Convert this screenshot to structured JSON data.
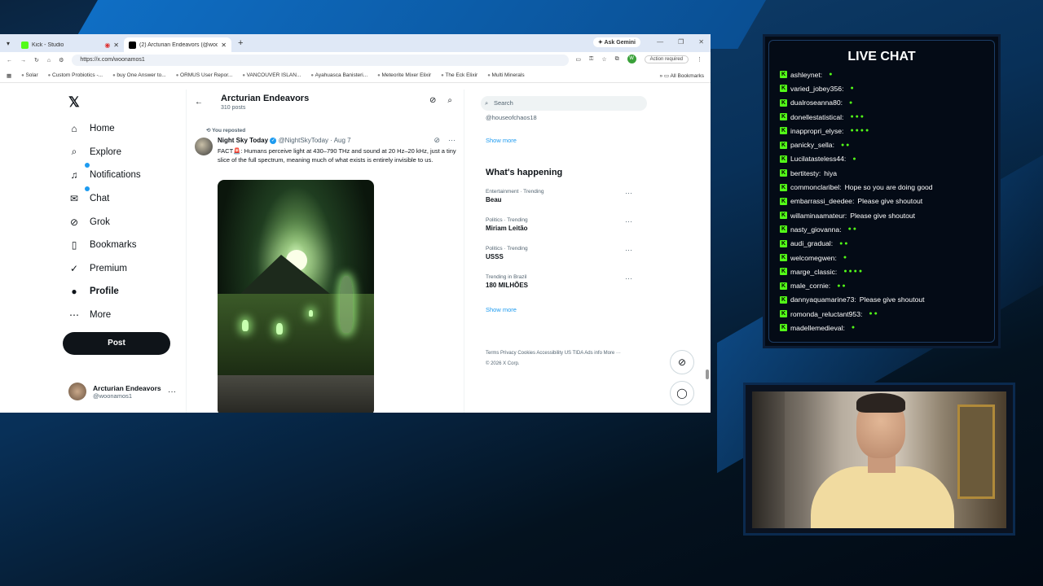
{
  "browser": {
    "tabs": [
      {
        "title": "Kick - Studio",
        "color": "#53fc18",
        "active": false
      },
      {
        "title": "(2) Arcturian Endeavors (@woo…",
        "color": "#000000",
        "active": true
      }
    ],
    "ask_gemini": "Ask Gemini",
    "url": "https://x.com/woonamos1",
    "profile_initial": "W",
    "action_required": "Action required",
    "bookmarks": [
      "Solar",
      "Custom Probiotics -...",
      "buy One Answer to...",
      "ORMUS User Repor...",
      "VANCOUVER ISLAN...",
      "Ayahuasca Banisteri...",
      "Meteorite Mixer Elixir",
      "The Eck Elixir",
      "Multi Minerals"
    ],
    "all_bookmarks": "All Bookmarks"
  },
  "nav": {
    "items": [
      {
        "label": "Home",
        "icon": "⌂"
      },
      {
        "label": "Explore",
        "icon": "⌕"
      },
      {
        "label": "Notifications",
        "icon": "🔔"
      },
      {
        "label": "Chat",
        "icon": "✉"
      },
      {
        "label": "Grok",
        "icon": "⊘"
      },
      {
        "label": "Bookmarks",
        "icon": "▯"
      },
      {
        "label": "Premium",
        "icon": "✓"
      },
      {
        "label": "Profile",
        "icon": "👤"
      },
      {
        "label": "More",
        "icon": "⋯"
      }
    ],
    "post_label": "Post",
    "account_name": "Arcturian Endeavors",
    "account_handle": "@woonamos1"
  },
  "profile_header": {
    "title": "Arcturian Endeavors",
    "subtitle": "310 posts"
  },
  "tweet": {
    "repost_label": "You reposted",
    "author": "Night Sky Today",
    "handle_date": "@NightSkyToday · Aug 7",
    "text": "FACT🚨: Humans perceive light at 430–790 THz and sound at 20 Hz–20 kHz, just a tiny slice of the full spectrum, meaning much of what exists is entirely invisible to us."
  },
  "sidebar": {
    "search_placeholder": "Search",
    "previous_handle": "@houseofchaos18",
    "show_more": "Show more",
    "whats_happening": "What's happening",
    "trends": [
      {
        "category": "Entertainment · Trending",
        "name": "Beau"
      },
      {
        "category": "Politics · Trending",
        "name": "Miriam Leitão"
      },
      {
        "category": "Politics · Trending",
        "name": "USSS"
      },
      {
        "category": "Trending in Brazil",
        "name": "180 MILHÕES"
      }
    ],
    "footer": "Terms    Privacy    Cookies    Accessibility    US TIDA    Ads info    More ···    © 2026 X Corp."
  },
  "live_chat": {
    "title": "LIVE CHAT",
    "accent": "#53fc18",
    "messages": [
      {
        "user": "ashleynet:",
        "text": "",
        "emotes": "●"
      },
      {
        "user": "varied_jobey356:",
        "text": "",
        "emotes": "●"
      },
      {
        "user": "dualroseanna80:",
        "text": "",
        "emotes": "●"
      },
      {
        "user": "donellestatistical:",
        "text": "",
        "emotes": "● ● ●"
      },
      {
        "user": "inappropri_elyse:",
        "text": "",
        "emotes": "● ● ● ●"
      },
      {
        "user": "panicky_sella:",
        "text": "",
        "emotes": "● ●"
      },
      {
        "user": "Lucilatasteless44:",
        "text": "",
        "emotes": "●"
      },
      {
        "user": "bertitesty:",
        "text": "hiya",
        "emotes": ""
      },
      {
        "user": "commonclaribel:",
        "text": "Hope so you are doing good",
        "emotes": ""
      },
      {
        "user": "embarrassi_deedee:",
        "text": "Please give shoutout",
        "emotes": ""
      },
      {
        "user": "willaminaamateur:",
        "text": "Please give shoutout",
        "emotes": ""
      },
      {
        "user": "nasty_giovanna:",
        "text": "",
        "emotes": "● ●"
      },
      {
        "user": "audi_gradual:",
        "text": "",
        "emotes": "● ●"
      },
      {
        "user": "welcomegwen:",
        "text": "",
        "emotes": "●"
      },
      {
        "user": "marge_classic:",
        "text": "",
        "emotes": "● ● ● ●"
      },
      {
        "user": "male_cornie:",
        "text": "",
        "emotes": "● ●"
      },
      {
        "user": "dannyaquamarine73:",
        "text": "Please give shoutout",
        "emotes": ""
      },
      {
        "user": "romonda_reluctant953:",
        "text": "",
        "emotes": "● ●"
      },
      {
        "user": "madellemedieval:",
        "text": "",
        "emotes": "●"
      }
    ]
  }
}
